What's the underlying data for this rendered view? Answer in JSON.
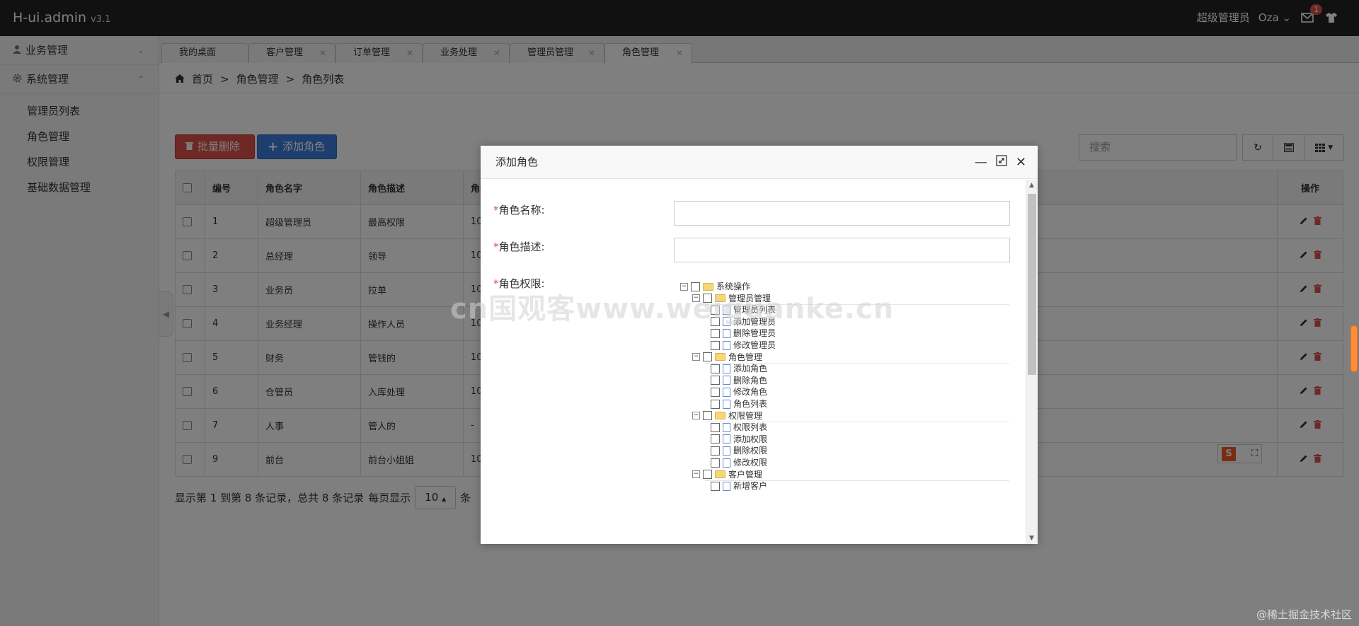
{
  "app": {
    "brand": "H-ui.admin",
    "version": "v3.1",
    "user_role": "超级管理员",
    "user_name": "Oza",
    "mail_badge": "1"
  },
  "sidebar": {
    "groups": [
      {
        "label": "业务管理"
      },
      {
        "label": "系统管理"
      }
    ],
    "items": [
      "管理员列表",
      "角色管理",
      "权限管理",
      "基础数据管理"
    ]
  },
  "tabs": [
    "我的桌面",
    "客户管理",
    "订单管理",
    "业务处理",
    "管理员管理",
    "角色管理"
  ],
  "breadcrumb": {
    "home": "首页",
    "level1": "角色管理",
    "level2": "角色列表",
    "sep": ">"
  },
  "toolbar": {
    "batch_delete": "批量删除",
    "add_role": "添加角色",
    "search_placeholder": "搜索"
  },
  "table": {
    "headers": [
      "编号",
      "角色名字",
      "角色描述",
      "角色",
      "操作"
    ],
    "rows": [
      {
        "id": "1",
        "name": "超级管理员",
        "desc": "最高权限",
        "col4": "10"
      },
      {
        "id": "2",
        "name": "总经理",
        "desc": "领导",
        "col4": "10"
      },
      {
        "id": "3",
        "name": "业务员",
        "desc": "拉单",
        "col4": "10"
      },
      {
        "id": "4",
        "name": "业务经理",
        "desc": "操作人员",
        "col4": "10"
      },
      {
        "id": "5",
        "name": "财务",
        "desc": "管钱的",
        "col4": "10"
      },
      {
        "id": "6",
        "name": "仓管员",
        "desc": "入库处理",
        "col4": "10"
      },
      {
        "id": "7",
        "name": "人事",
        "desc": "管人的",
        "col4": "-"
      },
      {
        "id": "9",
        "name": "前台",
        "desc": "前台小姐姐",
        "col4": "10"
      }
    ]
  },
  "pager": {
    "summary": "显示第 1 到第 8 条记录，总共 8 条记录",
    "per_page_label": "每页显示",
    "per_page_value": "10",
    "suffix": "条"
  },
  "dialog": {
    "title": "添加角色",
    "fields": {
      "role_name": "*角色名称:",
      "role_desc": "*角色描述:",
      "role_perm": "*角色权限:"
    },
    "tree": [
      {
        "label": "系统操作",
        "level": 0,
        "type": "folder"
      },
      {
        "label": "管理员管理",
        "level": 1,
        "type": "folder"
      },
      {
        "label": "管理员列表",
        "level": 2,
        "type": "file"
      },
      {
        "label": "添加管理员",
        "level": 2,
        "type": "file"
      },
      {
        "label": "删除管理员",
        "level": 2,
        "type": "file"
      },
      {
        "label": "修改管理员",
        "level": 2,
        "type": "file"
      },
      {
        "label": "角色管理",
        "level": 1,
        "type": "folder"
      },
      {
        "label": "添加角色",
        "level": 2,
        "type": "file"
      },
      {
        "label": "删除角色",
        "level": 2,
        "type": "file"
      },
      {
        "label": "修改角色",
        "level": 2,
        "type": "file"
      },
      {
        "label": "角色列表",
        "level": 2,
        "type": "file"
      },
      {
        "label": "权限管理",
        "level": 1,
        "type": "folder"
      },
      {
        "label": "权限列表",
        "level": 2,
        "type": "file"
      },
      {
        "label": "添加权限",
        "level": 2,
        "type": "file"
      },
      {
        "label": "删除权限",
        "level": 2,
        "type": "file"
      },
      {
        "label": "修改权限",
        "level": 2,
        "type": "file"
      },
      {
        "label": "客户管理",
        "level": 1,
        "type": "folder"
      },
      {
        "label": "新增客户",
        "level": 2,
        "type": "file"
      }
    ]
  },
  "watermark": {
    "center": "cn国观客www.weiguanke.cn",
    "corner": "@稀土掘金技术社区"
  },
  "colors": {
    "danger": "#dd514c",
    "primary": "#3b7ddd",
    "topbar": "#222222"
  }
}
